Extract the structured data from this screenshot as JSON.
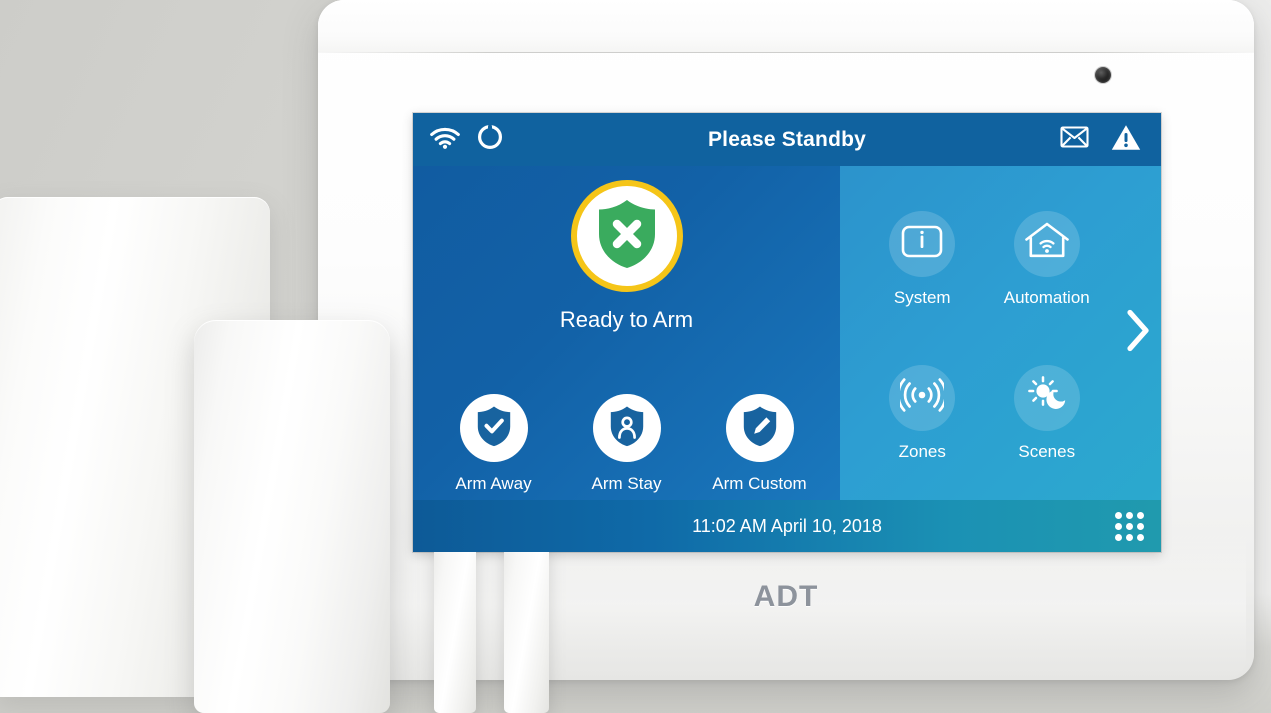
{
  "device": {
    "brand": "ADT",
    "camera_icon": "camera-lens"
  },
  "screen": {
    "status_bar": {
      "title": "Please Standby",
      "left_icons": [
        {
          "name": "wifi-icon",
          "label": "Wi-Fi"
        },
        {
          "name": "cellular-signal-icon",
          "label": "Cellular"
        }
      ],
      "right_icons": [
        {
          "name": "message-envelope-icon",
          "label": "Messages"
        },
        {
          "name": "alert-warning-icon",
          "label": "Alerts"
        }
      ]
    },
    "security": {
      "status_label": "Ready to Arm",
      "status_icon": "shield-x-icon",
      "ring_color": "#f5c518",
      "shield_color": "#3aab5e",
      "actions": [
        {
          "label": "Arm Away",
          "icon": "shield-check-icon"
        },
        {
          "label": "Arm Stay",
          "icon": "shield-person-icon"
        },
        {
          "label": "Arm Custom",
          "icon": "shield-pencil-icon"
        }
      ]
    },
    "tiles": [
      {
        "label": "System",
        "icon": "info-icon"
      },
      {
        "label": "Automation",
        "icon": "home-wifi-icon"
      },
      {
        "label": "Zones",
        "icon": "signal-waves-icon"
      },
      {
        "label": "Scenes",
        "icon": "sun-moon-icon"
      }
    ],
    "next_page_icon": "chevron-right-icon",
    "footer": {
      "datetime": "11:02 AM April 10, 2018",
      "keypad_icon": "keypad-grid-icon"
    },
    "colors": {
      "status_bar": "#10629f",
      "left_pane": "#1261a7",
      "right_pane": "#2d9ed2",
      "footer_start": "#0d5a97",
      "footer_end": "#209aae"
    }
  },
  "peripherals": [
    {
      "name": "motion-sensor-rear",
      "label": "Motion Sensor"
    },
    {
      "name": "motion-sensor-front",
      "label": "Motion Sensor"
    },
    {
      "name": "door-window-sensor-left",
      "label": "Door/Window Sensor"
    },
    {
      "name": "door-window-sensor-right",
      "label": "Door/Window Sensor"
    }
  ]
}
